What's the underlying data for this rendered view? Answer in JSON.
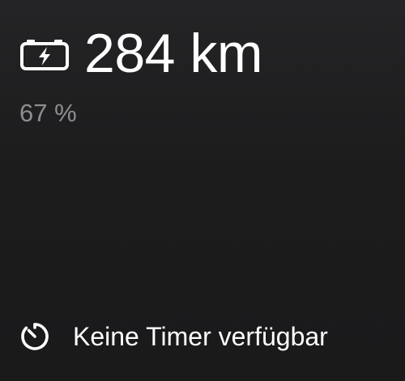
{
  "range": {
    "value": "284 km",
    "icon": "battery-charging-icon"
  },
  "battery": {
    "percent_text": "67 %"
  },
  "timer": {
    "label": "Keine Timer verfügbar",
    "icon": "timer-icon"
  },
  "colors": {
    "background": "#1c1c1d",
    "primary_text": "#ffffff",
    "secondary_text": "#8e8e90"
  }
}
